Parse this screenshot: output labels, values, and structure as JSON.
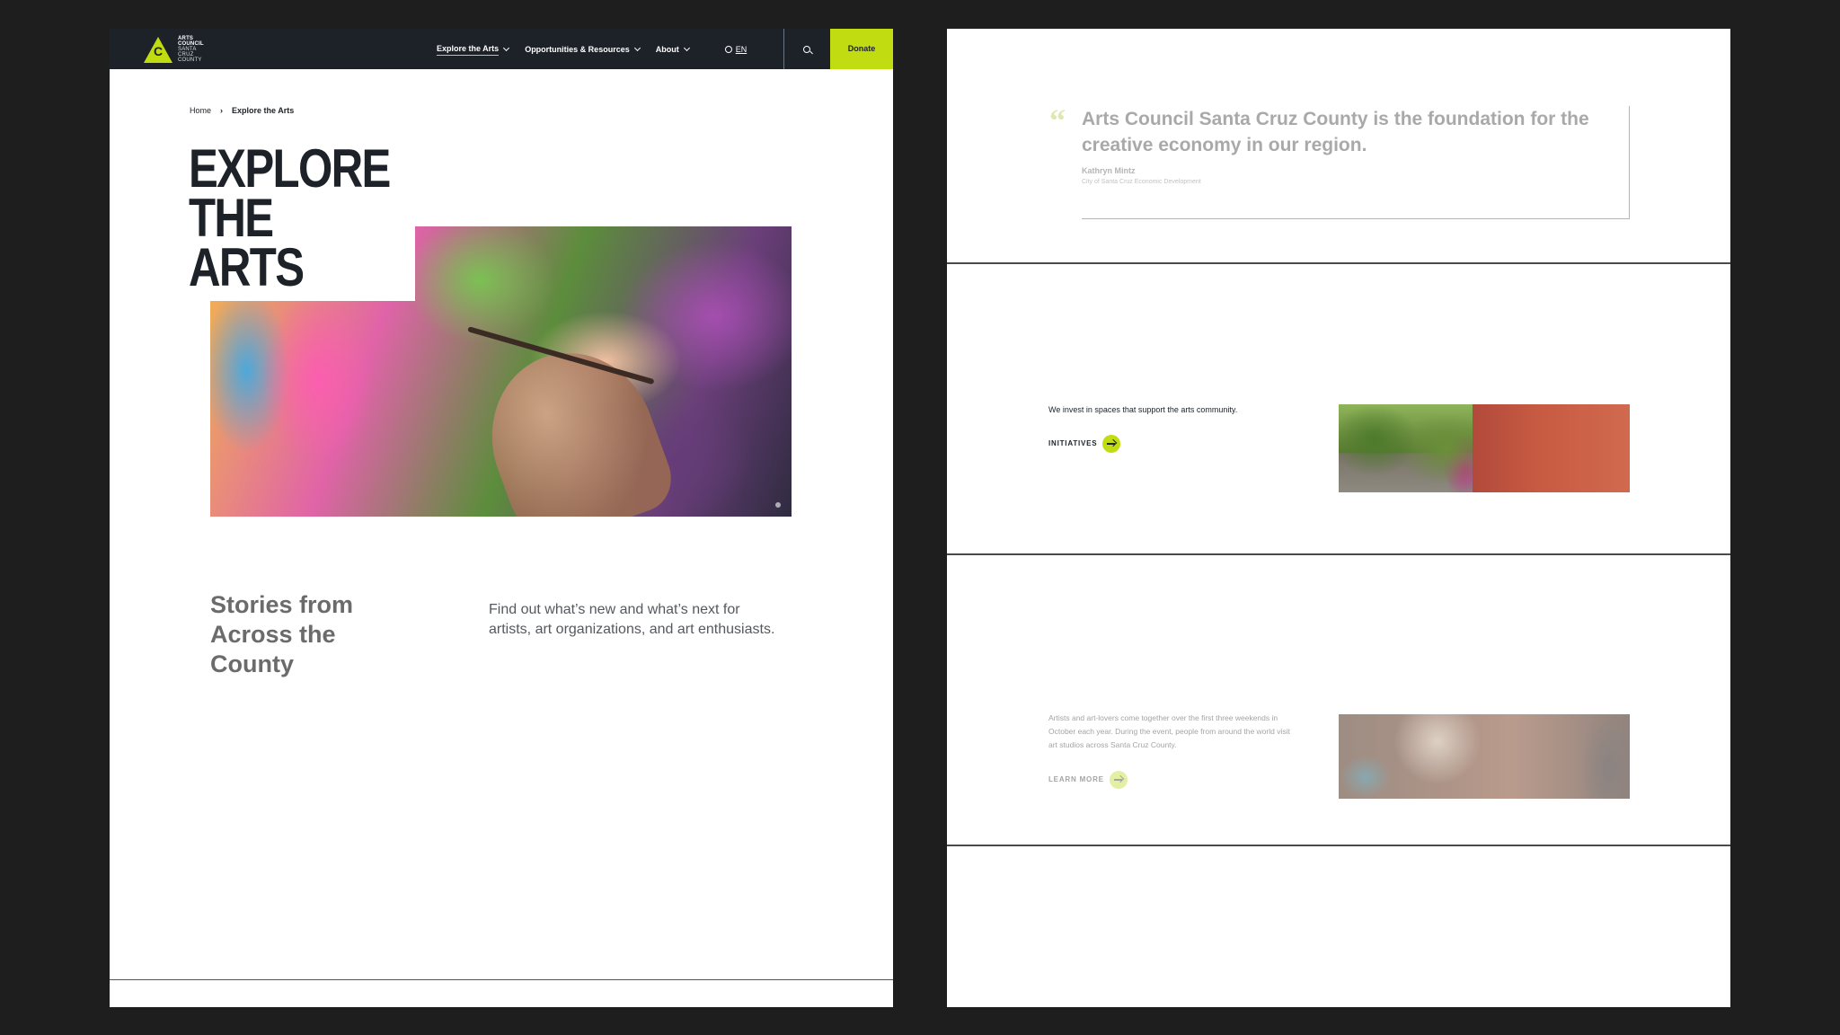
{
  "nav": {
    "logo": {
      "line1": "ARTS",
      "line2": "COUNCIL",
      "line3": "SANTA",
      "line4": "CRUZ",
      "line5": "COUNTY",
      "mark": "C"
    },
    "links": [
      {
        "label": "Explore the Arts",
        "active": true
      },
      {
        "label": "Opportunities & Resources",
        "active": false
      },
      {
        "label": "About",
        "active": false
      }
    ],
    "language": "EN",
    "donate_label": "Donate",
    "icons": {
      "search": "search-icon",
      "language": "globe-icon",
      "dropdown": "chevron-down-icon"
    }
  },
  "breadcrumb": {
    "home": "Home",
    "current": "Explore the Arts"
  },
  "hero": {
    "title_line1": "EXPLORE",
    "title_line2": "THE ARTS"
  },
  "stories": {
    "heading": "Stories from Across the County",
    "text": "Find out what’s new and what’s next for artists, art organizations, and art enthusiasts."
  },
  "quote": {
    "text": "Arts Council Santa Cruz County is the foundation for the creative economy in our region.",
    "author": "Kathryn Mintz",
    "organization": "City of Santa Cruz Economic Development"
  },
  "initiatives": {
    "text": "We invest in spaces that support the arts community.",
    "cta_label": "INITIATIVES"
  },
  "open_studios": {
    "text": "Artists and art-lovers come together over the first three weekends in October each year. During the event, people from around the world visit art studios across Santa Cruz County.",
    "cta_label": "LEARN MORE"
  },
  "colors": {
    "accent": "#c2dc12",
    "nav_bg": "#1c2228",
    "backdrop": "#1e1e1e"
  }
}
